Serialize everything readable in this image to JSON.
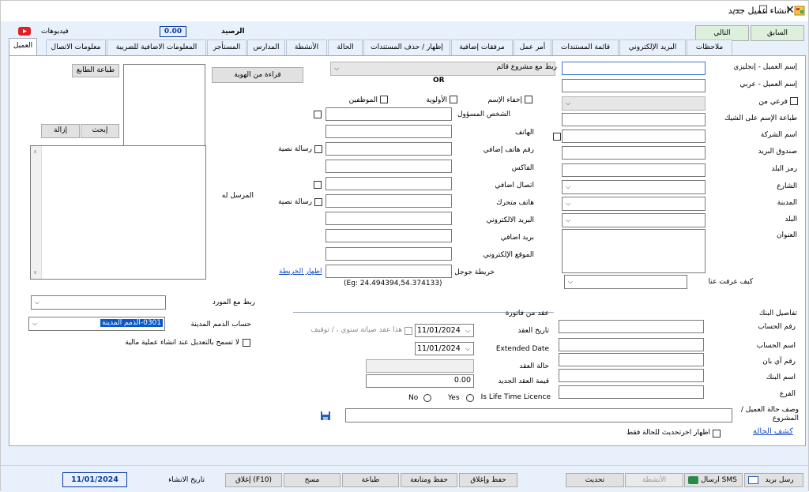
{
  "window": {
    "title": "انشاء عميل جديد",
    "min": "—",
    "max": "☐",
    "close": "✕"
  },
  "topbar": {
    "prev_label": "السابق",
    "next_label": "التالي",
    "balance_label": "الرصيد",
    "balance_value": "0.00",
    "videos_label": "فيديوهات"
  },
  "tabs": [
    "العميل",
    "معلومات الاتصال",
    "المعلومات الاضافية للضريبة",
    "المستأجر",
    "المدارس",
    "الأنشطة",
    "الحالة",
    "إظهار / حذف المستندات",
    "مرفقات إضافية",
    "أمر عمل",
    "قائمة المستندات",
    "البريد الإلكتروني",
    "ملاحظات"
  ],
  "right": {
    "name_en": "إسم العميل - إنجليزي",
    "name_ar": "إسم العميل - عربي",
    "branch_of": "فرعي من",
    "cheque_name": "طباعة الإسم على الشيك",
    "company": "اسم الشركة",
    "po_box": "صندوق البريد",
    "country_code": "رمز البلد",
    "street": "الشارع",
    "city": "المدينة",
    "country": "البلد",
    "address": "العنوان",
    "how_know": "كيف عرفت عنا"
  },
  "middle": {
    "link_project": "ربط مع مشروع قائم",
    "or": "OR",
    "hide_name": "إخفاء الإسم",
    "priority": "الأولوية",
    "employees": "الموظفين",
    "responsible": "الشخص المسؤول",
    "phone": "الهاتف",
    "extra_phone": "رقم هاتف إضافي",
    "sms1": "رسالة نصية",
    "fax": "الفاكس",
    "extra_contact": "اتصال اضافي",
    "mobile": "هاتف متحرك",
    "sms2": "رسالة نصية",
    "email": "البريد الالكتروني",
    "extra_email": "بريد اضافي",
    "website": "الموقع الإلكتروني",
    "google_map": "خريطة جوجل",
    "show_map": "اظهار الخريطة",
    "map_example": "(Eg: 24.494394,54.374133)",
    "read_id": "قراءة من الهوية",
    "sent_to": "المرسل له"
  },
  "left": {
    "print_label": "طباعة الطابع",
    "search": "إبحث",
    "remove": "إزالة",
    "link_supplier": "ربط مع المورد",
    "city_account_label": "حساب الذمم المدينة",
    "city_account_value": "0301-الذمم المدينة",
    "no_edit": "لا تسمح بالتعديل عند انشاء عملية مالية"
  },
  "bank": {
    "title": "تفاصيل البنك",
    "account_no": "رقم الحساب",
    "account_name": "اسم الحساب",
    "iban": "رقم آي بان",
    "bank_name": "اسم البنك",
    "branch": "الفرع"
  },
  "contract": {
    "from_invoice": "عقد من فاتورة",
    "contract_date": "تاريخ العقد",
    "date1": "11/01/2024",
    "annual": "هذا عقد صيانة سنوي ، / توقيف",
    "extended": "Extended Date",
    "date2": "11/01/2024",
    "status": "حالة العقد",
    "new_value": "قيمة العقد الجديد",
    "new_value_val": "0.00",
    "lifetime": "Is Life Time Licence",
    "yes": "Yes",
    "no": "No"
  },
  "desc": {
    "label": "وصف حالة العميل / المشروع",
    "report_link": "كشف الحالة",
    "show_latest": "اظهار اخرتحديث للحالة فقط"
  },
  "footer": {
    "send_mail": "رسل بريد",
    "send_sms": "ارسال SMS",
    "activities": "الأنشطة",
    "update": "تحديث",
    "save_close": "حفظ وإغلاق",
    "save_continue": "حفظ ومتابعة",
    "print": "طباعة",
    "clear": "مسح",
    "close": "إغلاق (F10)",
    "created_label": "تاريخ الانشاء",
    "created_date": "11/01/2024"
  },
  "colors": {
    "accent": "#0a3aa8",
    "highlight": "#0a58c9",
    "link": "#1a4fc7"
  }
}
